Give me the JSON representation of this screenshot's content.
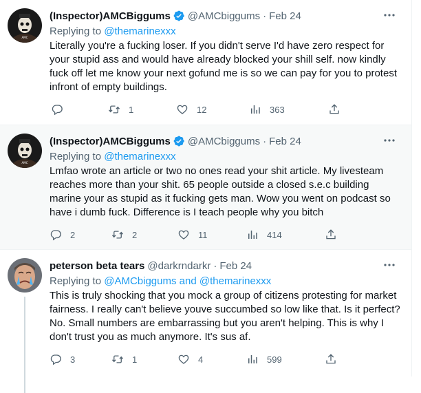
{
  "tweets": [
    {
      "name": "(Inspector)AMCBiggums",
      "verified": true,
      "handle": "@AMCbiggums",
      "separator": "·",
      "date": "Feb 24",
      "replying_label": "Replying to",
      "replying_to": "@themarinexxx",
      "text": "Literally you're a fucking loser. If you didn't serve I'd have zero respect for your stupid ass and would have already blocked your shill self. now kindly fuck off let me know your next gofund me is so we can pay for you to protest infront of empty buildings.",
      "replies": "",
      "retweets": "1",
      "likes": "12",
      "views": "363"
    },
    {
      "name": "(Inspector)AMCBiggums",
      "verified": true,
      "handle": "@AMCbiggums",
      "separator": "·",
      "date": "Feb 24",
      "replying_label": "Replying to",
      "replying_to": "@themarinexxx",
      "text": "Lmfao wrote an article or two no ones read your shit article. My livesteam reaches more than your shit. 65 people outside a closed s.e.c building marine your as stupid as it fucking gets man. Wow you went on podcast so have i dumb fuck. Difference is I teach people why you bitch",
      "replies": "2",
      "retweets": "2",
      "likes": "11",
      "views": "414"
    },
    {
      "name": "peterson beta tears",
      "verified": false,
      "handle": "@darkrndarkr",
      "separator": "·",
      "date": "Feb 24",
      "replying_label": "Replying to",
      "replying_to": "@AMCbiggums",
      "replying_and": "and",
      "replying_to_2": "@themarinexxx",
      "text": "This is truly shocking that you mock a group of citizens protesting for market fairness. I really can't believe youve succumbed so low like that. Is it perfect? No. Small numbers are embarrassing but you aren't helping. This is why I don't trust you as much anymore. It's sus af.",
      "replies": "3",
      "retweets": "1",
      "likes": "4",
      "views": "599"
    }
  ],
  "colors": {
    "text": "#0f1419",
    "secondary": "#536471",
    "link": "#1d9bf0",
    "verified": "#1d9bf0",
    "thread_line": "#cfd9de",
    "hover_bg": "#f7f9f9"
  },
  "icons": {
    "more": "more-horizontal-icon",
    "reply": "reply-icon",
    "retweet": "retweet-icon",
    "like": "heart-icon",
    "views": "views-chart-icon",
    "share": "share-icon",
    "verified": "verified-badge-icon"
  },
  "avatar_images": {
    "amc": "skull-face-avatar",
    "peterson": "crying-man-avatar"
  }
}
